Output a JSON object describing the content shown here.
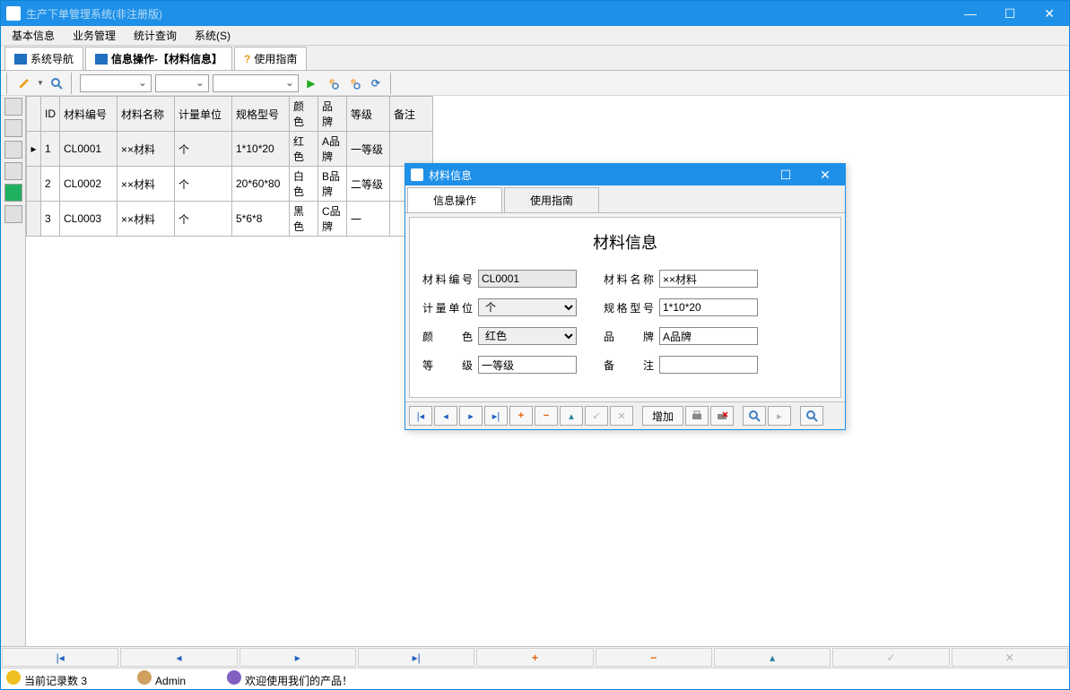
{
  "window": {
    "title": "生产下单管理系统(非注册版)"
  },
  "menu": {
    "basic": "基本信息",
    "business": "业务管理",
    "stats": "统计查询",
    "system": "系统(S)"
  },
  "tabs": {
    "nav": "系统导航",
    "info": "信息操作-【材料信息】",
    "guide": "使用指南"
  },
  "grid": {
    "headers": {
      "id": "ID",
      "code": "材料编号",
      "name": "材料名称",
      "unit": "计量单位",
      "spec": "规格型号",
      "color": "颜色",
      "brand": "品牌",
      "grade": "等级",
      "remark": "备注"
    },
    "rows": [
      {
        "n": "1",
        "code": "CL0001",
        "name": "××材料",
        "unit": "个",
        "spec": "1*10*20",
        "color": "红色",
        "brand": "A品牌",
        "grade": "一等级",
        "remark": ""
      },
      {
        "n": "2",
        "code": "CL0002",
        "name": "××材料",
        "unit": "个",
        "spec": "20*60*80",
        "color": "白色",
        "brand": "B品牌",
        "grade": "二等级",
        "remark": ""
      },
      {
        "n": "3",
        "code": "CL0003",
        "name": "××材料",
        "unit": "个",
        "spec": "5*6*8",
        "color": "黑色",
        "brand": "C品牌",
        "grade": "一",
        "remark": ""
      }
    ]
  },
  "dialog": {
    "title": "材料信息",
    "tab1": "信息操作",
    "tab2": "使用指南",
    "heading": "材料信息",
    "labels": {
      "code": "材料编号",
      "name": "材料名称",
      "unit": "计量单位",
      "spec": "规格型号",
      "color": "颜　　色",
      "brand": "品　　牌",
      "grade": "等　　级",
      "remark": "备　　注"
    },
    "values": {
      "code": "CL0001",
      "name": "××材料",
      "unit": "个",
      "spec": "1*10*20",
      "color": "红色",
      "brand": "A品牌",
      "grade": "一等级",
      "remark": ""
    },
    "addBtn": "增加"
  },
  "status": {
    "count_label": "当前记录数",
    "count": "3",
    "user": "Admin",
    "welcome": "欢迎使用我们的产品！"
  }
}
